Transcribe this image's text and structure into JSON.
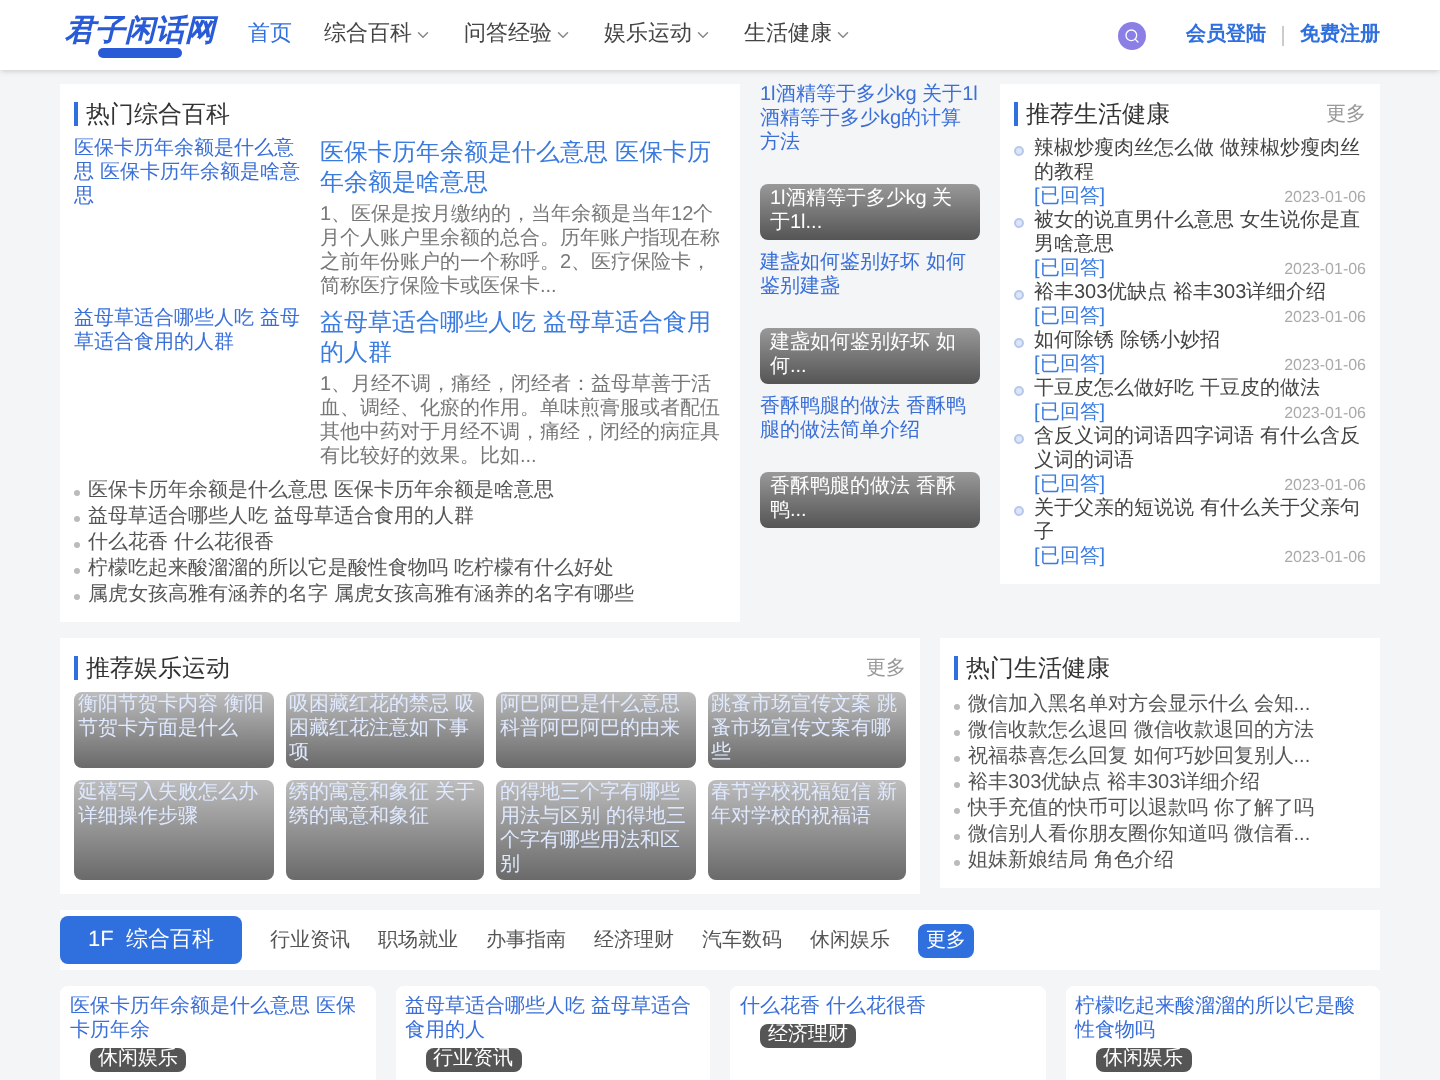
{
  "header": {
    "logo": "君子闲话网",
    "nav": [
      {
        "label": "首页",
        "selected": true,
        "dropdown": false
      },
      {
        "label": "综合百科",
        "selected": false,
        "dropdown": true
      },
      {
        "label": "问答经验",
        "selected": false,
        "dropdown": true
      },
      {
        "label": "娱乐运动",
        "selected": false,
        "dropdown": true
      },
      {
        "label": "生活健康",
        "selected": false,
        "dropdown": true
      }
    ],
    "login": "会员登陆",
    "register": "免费注册"
  },
  "hot_general": {
    "title": "热门综合百科",
    "articles": [
      {
        "image_alt": "医保卡历年余额是什么意思 医保卡历年余额是啥意思",
        "title": "医保卡历年余额是什么意思 医保卡历年余额是啥意思",
        "summary": "1、医保是按月缴纳的，当年余额是当年12个月个人账户里余额的总合。历年账户指现在称之前年份账户的一个称呼。2、医疗保险卡，简称医疗保险卡或医保卡..."
      },
      {
        "image_alt": "益母草适合哪些人吃 益母草适合食用的人群",
        "title": "益母草适合哪些人吃 益母草适合食用的人群",
        "summary": "1、月经不调，痛经，闭经者：益母草善于活血、调经、化瘀的作用。单味煎膏服或者配伍其他中药对于月经不调，痛经，闭经的病症具有比较好的效果。比如..."
      }
    ],
    "list": [
      "医保卡历年余额是什么意思 医保卡历年余额是啥意思",
      "益母草适合哪些人吃 益母草适合食用的人群",
      "什么花香 什么花很香",
      "柠檬吃起来酸溜溜的所以它是酸性食物吗 吃柠檬有什么好处",
      "属虎女孩高雅有涵养的名字 属虎女孩高雅有涵养的名字有哪些"
    ]
  },
  "feature_images": [
    {
      "image_alt": "1l酒精等于多少kg 关于1l酒精等于多少kg的计算方法",
      "caption": "1l酒精等于多少kg 关于1l..."
    },
    {
      "image_alt": "建盏如何鉴别好坏 如何鉴别建盏",
      "caption": "建盏如何鉴别好坏 如何..."
    },
    {
      "image_alt": "香酥鸭腿的做法 香酥鸭腿的做法简单介绍",
      "caption": "香酥鸭腿的做法 香酥鸭..."
    }
  ],
  "recommended_life": {
    "title": "推荐生活健康",
    "more": "更多",
    "items": [
      {
        "title": "辣椒炒瘦肉丝怎么做 做辣椒炒瘦肉丝的教程",
        "status": "[已回答]",
        "date": "2023-01-06"
      },
      {
        "title": "被女的说直男什么意思 女生说你是直男啥意思",
        "status": "[已回答]",
        "date": "2023-01-06"
      },
      {
        "title": "裕丰303优缺点 裕丰303详细介绍",
        "status": "[已回答]",
        "date": "2023-01-06"
      },
      {
        "title": "如何除锈 除锈小妙招",
        "status": "[已回答]",
        "date": "2023-01-06"
      },
      {
        "title": "干豆皮怎么做好吃 干豆皮的做法",
        "status": "[已回答]",
        "date": "2023-01-06"
      },
      {
        "title": "含反义词的词语四字词语 有什么含反义词的词语",
        "status": "[已回答]",
        "date": "2023-01-06"
      },
      {
        "title": "关于父亲的短说说 有什么关于父亲句子",
        "status": "[已回答]",
        "date": "2023-01-06"
      }
    ]
  },
  "recommended_entertainment": {
    "title": "推荐娱乐运动",
    "more": "更多",
    "items": [
      {
        "image_alt": "衡阳节贺卡内容 衡阳节贺卡方面是什么"
      },
      {
        "image_alt": "吸困藏红花的禁忌 吸困藏红花注意如下事项"
      },
      {
        "image_alt": "阿巴阿巴是什么意思科普阿巴阿巴的由来"
      },
      {
        "image_alt": "跳蚤市场宣传文案 跳蚤市场宣传文案有哪些"
      },
      {
        "image_alt": "延禧写入失败怎么办详细操作步骤"
      },
      {
        "image_alt": "绣的寓意和象征 关于绣的寓意和象征"
      },
      {
        "image_alt": "的得地三个字有哪些用法与区别 的得地三个字有哪些用法和区别"
      },
      {
        "image_alt": "春节学校祝福短信 新年对学校的祝福语"
      }
    ]
  },
  "hot_life": {
    "title": "热门生活健康",
    "items": [
      "微信加入黑名单对方会显示什么 会知...",
      "微信收款怎么退回 微信收款退回的方法",
      "祝福恭喜怎么回复 如何巧妙回复别人...",
      "裕丰303优缺点 裕丰303详细介绍",
      "快手充值的快币可以退款吗 你了解了吗",
      "微信别人看你朋友圈你知道吗 微信看...",
      "姐妹新娘结局 角色介绍"
    ]
  },
  "category_bar": {
    "floor": "1F",
    "title": "综合百科",
    "tabs": [
      "行业资讯",
      "职场就业",
      "办事指南",
      "经济理财",
      "汽车数码",
      "休闲娱乐"
    ],
    "more": "更多"
  },
  "cards": [
    {
      "image_alt": "医保卡历年余额是什么意思 医保卡历年余",
      "tag": "休闲娱乐"
    },
    {
      "image_alt": "益母草适合哪些人吃 益母草适合食用的人",
      "tag": "行业资讯"
    },
    {
      "image_alt": "什么花香 什么花很香",
      "tag": "经济理财"
    },
    {
      "image_alt": "柠檬吃起来酸溜溜的所以它是酸性食物吗",
      "tag": "休闲娱乐"
    }
  ]
}
